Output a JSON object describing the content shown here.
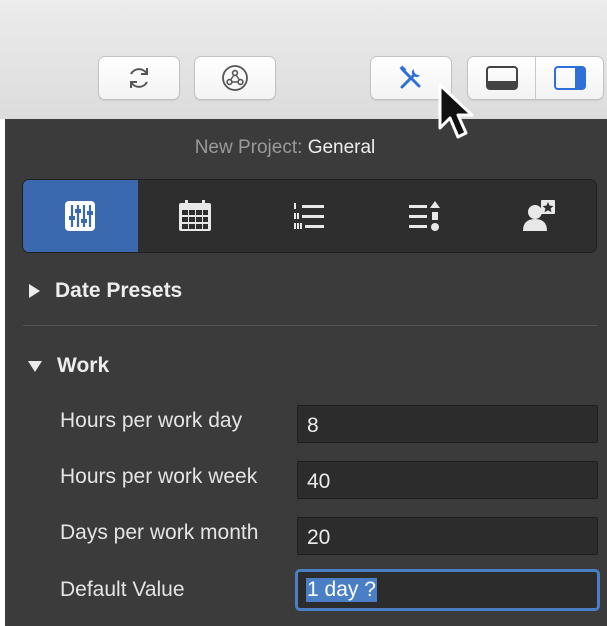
{
  "toolbar": {
    "buttons": [
      {
        "icon": "refresh-icon"
      },
      {
        "icon": "network-icon"
      },
      {
        "icon": "inspector-tools-icon",
        "active": true
      }
    ],
    "view_toggle": [
      {
        "icon": "bottom-pane-icon"
      },
      {
        "icon": "right-sidebar-icon",
        "active": true
      }
    ]
  },
  "inspector": {
    "title_prefix": "New Project:",
    "title_name": "General",
    "tabs": [
      {
        "icon": "sliders-icon",
        "active": true
      },
      {
        "icon": "calendar-icon"
      },
      {
        "icon": "list-icon"
      },
      {
        "icon": "sort-list-icon"
      },
      {
        "icon": "person-star-icon"
      }
    ]
  },
  "sections": {
    "date_presets": {
      "label": "Date Presets",
      "expanded": false
    },
    "work": {
      "label": "Work",
      "expanded": true
    }
  },
  "work_fields": [
    {
      "label": "Hours per work day",
      "value": "8"
    },
    {
      "label": "Hours per work week",
      "value": "40"
    },
    {
      "label": "Days per work month",
      "value": "20"
    },
    {
      "label": "Default Value",
      "value": "1 day ?",
      "focused": true,
      "selected": true
    }
  ],
  "colors": {
    "panel_bg": "#3b3b3b",
    "accent": "#3a69b0",
    "focus_ring": "#4a7fc6"
  }
}
